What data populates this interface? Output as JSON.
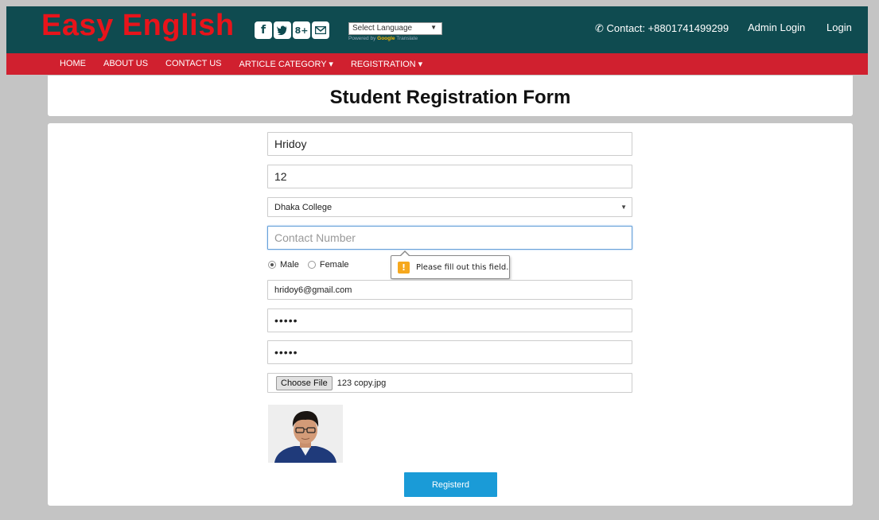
{
  "header": {
    "brand": "Easy English",
    "social_icons": [
      "facebook-icon",
      "twitter-icon",
      "google-plus-icon",
      "email-icon"
    ],
    "language_select": "Select Language",
    "powered_by": "Powered by",
    "google": "Google",
    "translate": "Translate",
    "contact": "Contact: +8801741499299",
    "admin_login": "Admin Login",
    "login": "Login"
  },
  "nav": {
    "items": [
      "HOME",
      "ABOUT US",
      "CONTACT US",
      "ARTICLE CATEGORY ▾",
      "REGISTRATION ▾"
    ]
  },
  "page": {
    "title": "Student Registration Form"
  },
  "form": {
    "name_value": "Hridoy",
    "roll_value": "12",
    "college_value": "Dhaka College",
    "contact_placeholder": "Contact Number",
    "gender_male": "Male",
    "gender_female": "Female",
    "gender_selected": "Male",
    "email_value": "hridoy6@gmail.com",
    "password_value": "•••••",
    "confirm_password_value": "•••••",
    "file_button": "Choose File",
    "file_name": "123 copy.jpg",
    "validation_message": "Please fill out this field.",
    "submit_label": "Registerd"
  },
  "colors": {
    "topbar": "#0f4b50",
    "brand": "#e8141b",
    "navbar": "#d0202f",
    "submit": "#1a9bd7",
    "background": "#c4c4c4"
  }
}
